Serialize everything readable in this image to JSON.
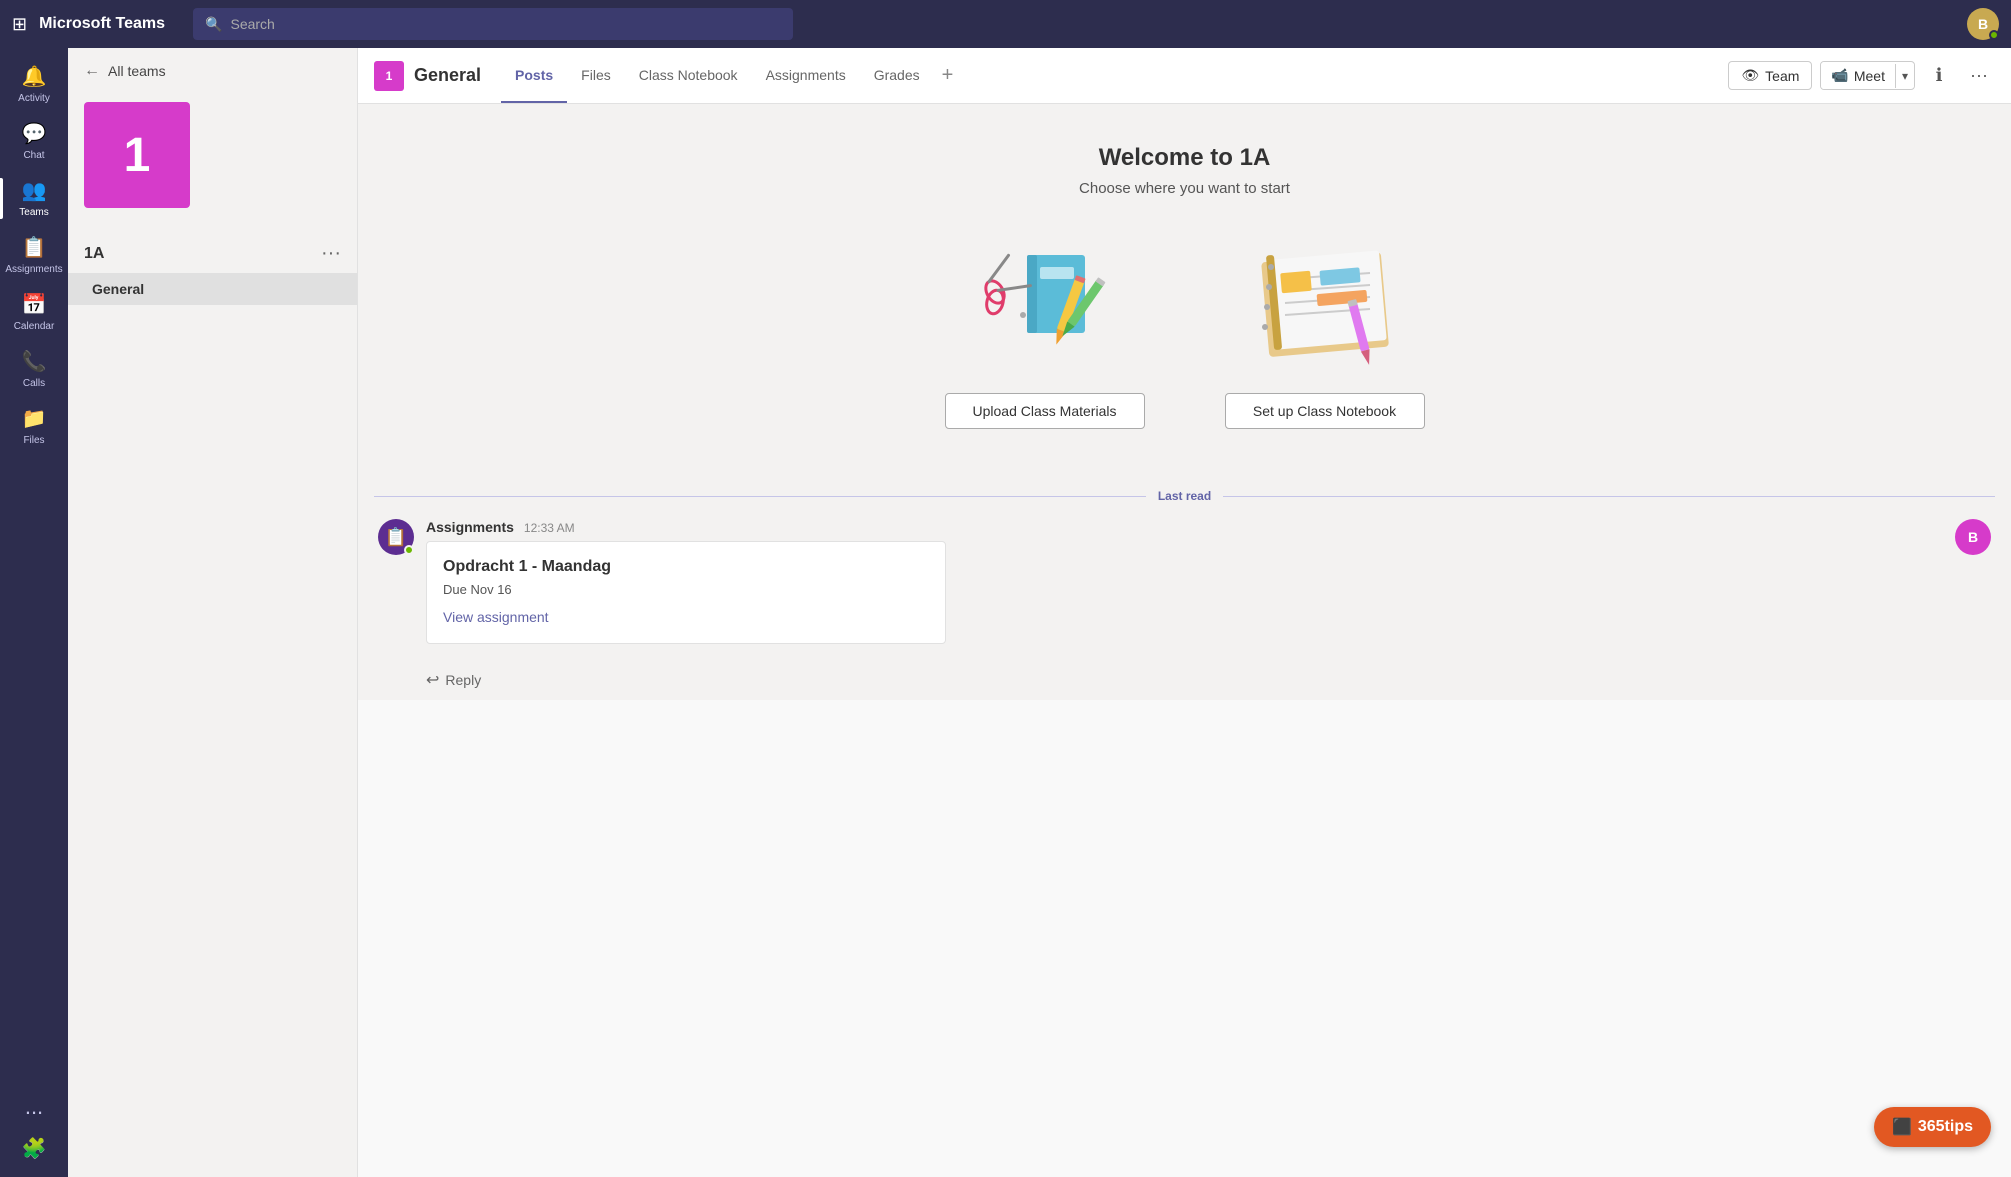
{
  "app": {
    "title": "Microsoft Teams"
  },
  "topbar": {
    "title": "Microsoft Teams",
    "search_placeholder": "Search",
    "avatar_initials": "B",
    "grid_icon": "⊞"
  },
  "sidebar": {
    "items": [
      {
        "id": "activity",
        "label": "Activity",
        "icon": "🔔"
      },
      {
        "id": "chat",
        "label": "Chat",
        "icon": "💬"
      },
      {
        "id": "teams",
        "label": "Teams",
        "icon": "👥",
        "active": true
      },
      {
        "id": "assignments",
        "label": "Assignments",
        "icon": "📋"
      },
      {
        "id": "calendar",
        "label": "Calendar",
        "icon": "📅"
      },
      {
        "id": "calls",
        "label": "Calls",
        "icon": "📞"
      },
      {
        "id": "files",
        "label": "Files",
        "icon": "📁"
      }
    ],
    "more_label": "...",
    "apps_icon": "🧩"
  },
  "teams_panel": {
    "back_label": "All teams",
    "team_number": "1",
    "team_name": "1A",
    "more_icon": "···",
    "channels": [
      {
        "id": "general",
        "label": "General",
        "active": true
      }
    ]
  },
  "channel_header": {
    "badge": "1",
    "channel_name": "General",
    "tabs": [
      {
        "id": "posts",
        "label": "Posts",
        "active": true
      },
      {
        "id": "files",
        "label": "Files"
      },
      {
        "id": "class-notebook",
        "label": "Class Notebook"
      },
      {
        "id": "assignments",
        "label": "Assignments"
      },
      {
        "id": "grades",
        "label": "Grades"
      }
    ],
    "add_label": "+",
    "team_btn": "Team",
    "team_icon": "👁",
    "meet_btn": "Meet",
    "meet_icon": "📹",
    "info_icon": "ℹ",
    "more_icon": "···"
  },
  "welcome": {
    "title": "Welcome to 1A",
    "subtitle": "Choose where you want to start",
    "cards": [
      {
        "id": "upload",
        "button_label": "Upload Class Materials"
      },
      {
        "id": "notebook",
        "button_label": "Set up Class Notebook"
      }
    ]
  },
  "last_read": {
    "label": "Last read"
  },
  "message": {
    "sender": "Assignments",
    "time": "12:33 AM",
    "assignment_title": "Opdracht 1 - Maandag",
    "due_label": "Due Nov 16",
    "view_assignment_label": "View assignment",
    "reply_label": "Reply"
  },
  "badge_365tips": {
    "label": "365tips"
  }
}
